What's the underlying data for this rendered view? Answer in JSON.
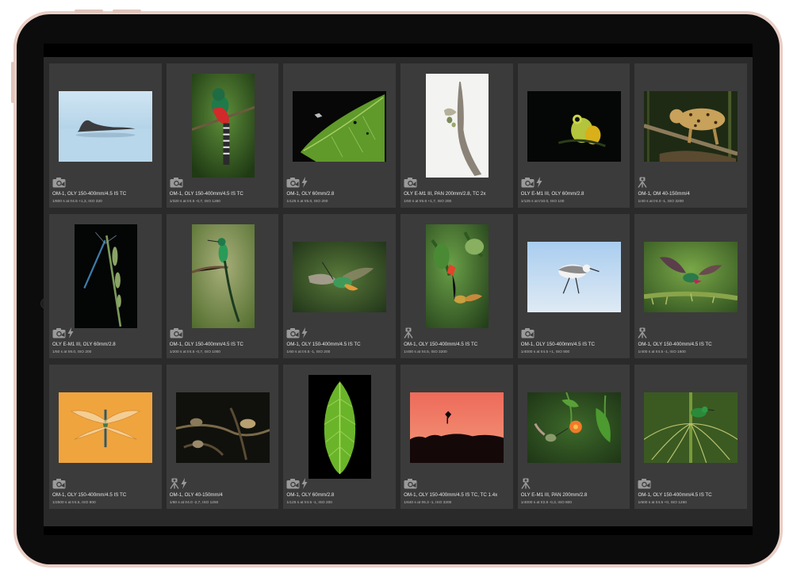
{
  "device": {
    "name": "tablet"
  },
  "colors": {
    "background": "#2a2a2a",
    "cell": "#3b3b3b",
    "badge": "#9a9a9a"
  },
  "photos": [
    {
      "caption": "OM-1, OLY 150-400mm/4.5 IS TC",
      "exif": "1/800 s at f/4.5 +1,3, ISO 320",
      "badges": [
        "camera-icon"
      ],
      "orientation": "landscape",
      "subject": "marine-iguana"
    },
    {
      "caption": "OM-1, OLY 150-400mm/4.5 IS TC",
      "exif": "1/320 s at f/4.5 -0,7, ISO 1250",
      "badges": [
        "camera-icon"
      ],
      "orientation": "portrait",
      "subject": "trogon"
    },
    {
      "caption": "OM-1, OLY 60mm/2.8",
      "exif": "1/125 s at f/5.0, ISO 200",
      "badges": [
        "camera-icon",
        "flash-icon"
      ],
      "orientation": "landscape",
      "subject": "leaf-insect"
    },
    {
      "caption": "OLY E-M1 III, PAN 200mm/2.8, TC 2x",
      "exif": "1/50 s at f/5.6 +1,7, ISO 200",
      "badges": [
        "camera-icon"
      ],
      "orientation": "portrait",
      "subject": "branch-bird"
    },
    {
      "caption": "OLY E-M1 III, OLY 60mm/2.8",
      "exif": "1/125 s at f/10.0, ISO 100",
      "badges": [
        "camera-icon",
        "flash-icon"
      ],
      "orientation": "landscape",
      "subject": "frog"
    },
    {
      "caption": "OM-1, OM 40-150mm/4",
      "exif": "1/40 s at f/4.0 -1, ISO 3200",
      "badges": [
        "tripod-icon"
      ],
      "orientation": "landscape",
      "subject": "ocelot"
    },
    {
      "caption": "OLY E-M1 III, OLY 60mm/2.8",
      "exif": "1/50 s at f/8.0, ISO 200",
      "badges": [
        "camera-icon",
        "flash-icon"
      ],
      "orientation": "portrait",
      "subject": "damselfly"
    },
    {
      "caption": "OM-1, OLY 150-400mm/4.5 IS TC",
      "exif": "1/200 s at f/4.5 -0,7, ISO 1000",
      "badges": [
        "camera-icon"
      ],
      "orientation": "portrait",
      "subject": "longtail-hummingbird"
    },
    {
      "caption": "OM-1, OLY 150-400mm/4.5 IS TC",
      "exif": "1/60 s at f/4.5 -1, ISO 200",
      "badges": [
        "camera-icon",
        "flash-icon"
      ],
      "orientation": "landscape",
      "subject": "hummingbird-flight"
    },
    {
      "caption": "OM-1, OLY 150-400mm/4.5 IS TC",
      "exif": "1/400 s at f/4.5, ISO 3200",
      "badges": [
        "tripod-icon"
      ],
      "orientation": "portrait",
      "subject": "hummingbird-flower"
    },
    {
      "caption": "OM-1, OLY 150-400mm/4.5 IS TC",
      "exif": "1/4000 s at f/4.5 +1, ISO 800",
      "badges": [
        "camera-icon"
      ],
      "orientation": "landscape",
      "subject": "sanderling"
    },
    {
      "caption": "OM-1, OLY 150-400mm/4.5 IS TC",
      "exif": "1/400 s at f/4.5 -1, ISO 1600",
      "badges": [
        "tripod-icon"
      ],
      "orientation": "landscape",
      "subject": "hummingbird-moss"
    },
    {
      "caption": "OM-1, OLY 150-400mm/4.5 IS TC",
      "exif": "1/2500 s at f/4.5, ISO 800",
      "badges": [
        "camera-icon"
      ],
      "orientation": "landscape",
      "subject": "dragonfly"
    },
    {
      "caption": "OM-1, OLY 40-150mm/4",
      "exif": "1/80 s at f/4.0 -2,7, ISO 1250",
      "badges": [
        "tripod-icon",
        "flash-icon"
      ],
      "orientation": "landscape",
      "subject": "night-animals"
    },
    {
      "caption": "OM-1, OLY 60mm/2.8",
      "exif": "1/125 s at f/4.5 -1, ISO 200",
      "badges": [
        "camera-icon",
        "flash-icon"
      ],
      "orientation": "portrait",
      "subject": "green-leaf"
    },
    {
      "caption": "OM-1, OLY 150-400mm/4.5 IS TC, TC 1.4x",
      "exif": "1/640 s at f/6.3 -1, ISO 3200",
      "badges": [
        "camera-icon"
      ],
      "orientation": "landscape",
      "subject": "sunset-silhouette"
    },
    {
      "caption": "OLY E-M1 III, PAN 200mm/2.8",
      "exif": "1/4000 s at f/2.8 -0,3, ISO 800",
      "badges": [
        "tripod-icon"
      ],
      "orientation": "landscape",
      "subject": "hummingbird-orange"
    },
    {
      "caption": "OM-1, OLY 150-400mm/4.5 IS TC",
      "exif": "1/500 s at f/4.5 +0, ISO 1250",
      "badges": [
        "camera-icon"
      ],
      "orientation": "landscape",
      "subject": "green-bird-palm"
    }
  ]
}
